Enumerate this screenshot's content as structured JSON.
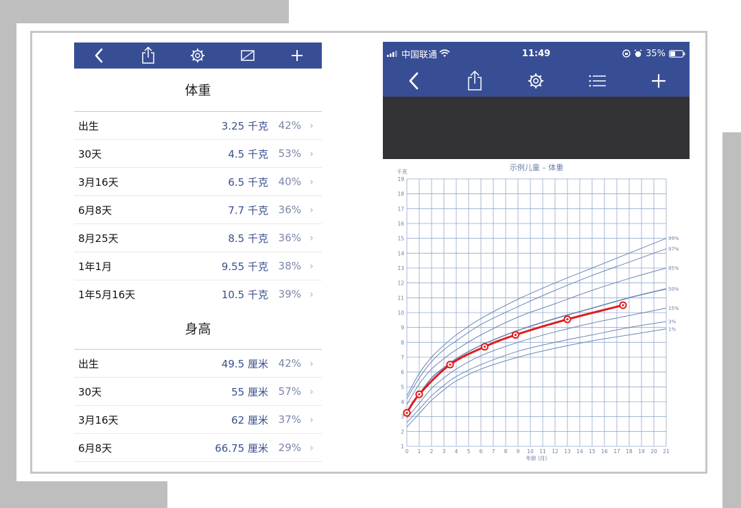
{
  "left_toolbar": {
    "icons": [
      "back-icon",
      "share-icon",
      "gear-icon",
      "chart-icon",
      "plus-icon"
    ]
  },
  "weight_section": {
    "title": "体重",
    "rows": [
      {
        "age": "出生",
        "value": "3.25 千克",
        "percent": "42%"
      },
      {
        "age": "30天",
        "value": "4.5 千克",
        "percent": "53%"
      },
      {
        "age": "3月16天",
        "value": "6.5 千克",
        "percent": "40%"
      },
      {
        "age": "6月8天",
        "value": "7.7 千克",
        "percent": "36%"
      },
      {
        "age": "8月25天",
        "value": "8.5 千克",
        "percent": "36%"
      },
      {
        "age": "1年1月",
        "value": "9.55 千克",
        "percent": "38%"
      },
      {
        "age": "1年5月16天",
        "value": "10.5 千克",
        "percent": "39%"
      }
    ]
  },
  "height_section": {
    "title": "身高",
    "rows": [
      {
        "age": "出生",
        "value": "49.5 厘米",
        "percent": "42%"
      },
      {
        "age": "30天",
        "value": "55 厘米",
        "percent": "57%"
      },
      {
        "age": "3月16天",
        "value": "62 厘米",
        "percent": "37%"
      },
      {
        "age": "6月8天",
        "value": "66.75 厘米",
        "percent": "29%"
      }
    ]
  },
  "status_bar": {
    "carrier": "中国联通",
    "time": "11:49",
    "battery": "35%"
  },
  "right_nav": {
    "icons": [
      "back-icon",
      "share-icon",
      "gear-icon",
      "list-icon",
      "plus-icon"
    ]
  },
  "colors": {
    "nav_bar": "#384e94",
    "dark_panel": "#333335",
    "grid": "#8fa6cc",
    "percentile_curve": "#6b85b5",
    "child_curve": "#e21a1a",
    "value_text": "#3a4f8c"
  },
  "chart_data": {
    "type": "line",
    "title": "示例儿童 – 体重",
    "ylabel": "千克",
    "xlabel": "年龄 (月)",
    "xlim": [
      0,
      21
    ],
    "ylim": [
      1,
      19
    ],
    "x_ticks": [
      0,
      1,
      2,
      3,
      4,
      5,
      6,
      7,
      8,
      9,
      10,
      11,
      12,
      13,
      14,
      15,
      16,
      17,
      18,
      19,
      20,
      21
    ],
    "y_ticks": [
      1,
      2,
      3,
      4,
      5,
      6,
      7,
      8,
      9,
      10,
      11,
      12,
      13,
      14,
      15,
      16,
      17,
      18,
      19
    ],
    "grid": true,
    "percentile_curves": [
      {
        "name": "99%",
        "x": [
          0,
          1,
          2,
          3,
          4,
          6,
          9,
          12,
          15,
          18,
          21
        ],
        "y": [
          4.4,
          5.9,
          7.0,
          7.8,
          8.5,
          9.6,
          10.9,
          12.0,
          13.0,
          14.0,
          15.0
        ]
      },
      {
        "name": "97%",
        "x": [
          0,
          1,
          2,
          3,
          4,
          6,
          9,
          12,
          15,
          18,
          21
        ],
        "y": [
          4.2,
          5.6,
          6.7,
          7.5,
          8.1,
          9.2,
          10.4,
          11.5,
          12.5,
          13.4,
          14.3
        ]
      },
      {
        "name": "85%",
        "x": [
          0,
          1,
          2,
          3,
          4,
          6,
          9,
          12,
          15,
          18,
          21
        ],
        "y": [
          3.8,
          5.2,
          6.2,
          6.9,
          7.5,
          8.5,
          9.7,
          10.6,
          11.5,
          12.3,
          13.0
        ]
      },
      {
        "name": "50%",
        "x": [
          0,
          1,
          2,
          3,
          4,
          6,
          9,
          12,
          15,
          18,
          21
        ],
        "y": [
          3.3,
          4.5,
          5.6,
          6.3,
          6.9,
          7.8,
          8.8,
          9.6,
          10.3,
          11.0,
          11.6
        ]
      },
      {
        "name": "15%",
        "x": [
          0,
          1,
          2,
          3,
          4,
          6,
          9,
          12,
          15,
          18,
          21
        ],
        "y": [
          2.9,
          3.9,
          4.9,
          5.6,
          6.2,
          7.1,
          8.0,
          8.7,
          9.3,
          9.8,
          10.3
        ]
      },
      {
        "name": "3%",
        "x": [
          0,
          1,
          2,
          3,
          4,
          6,
          9,
          12,
          15,
          18,
          21
        ],
        "y": [
          2.6,
          3.5,
          4.4,
          5.1,
          5.7,
          6.5,
          7.4,
          8.0,
          8.5,
          9.0,
          9.4
        ]
      },
      {
        "name": "1%",
        "x": [
          0,
          1,
          2,
          3,
          4,
          6,
          9,
          12,
          15,
          18,
          21
        ],
        "y": [
          2.3,
          3.2,
          4.1,
          4.8,
          5.4,
          6.2,
          7.0,
          7.6,
          8.1,
          8.5,
          8.9
        ]
      }
    ],
    "child_series": {
      "x": [
        0,
        1,
        3.5,
        6.3,
        8.8,
        13.0,
        17.5
      ],
      "y": [
        3.25,
        4.5,
        6.5,
        7.7,
        8.5,
        9.55,
        10.5
      ]
    }
  }
}
